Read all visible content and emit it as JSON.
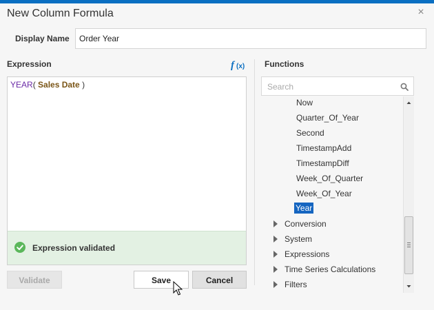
{
  "dialog": {
    "title": "New Column Formula",
    "close_glyph": "×"
  },
  "display_name": {
    "label": "Display Name",
    "value": "Order Year"
  },
  "expression": {
    "label": "Expression",
    "fx_icon": "function-fx-icon",
    "tokens": {
      "function": "YEAR",
      "open_paren": "(",
      "column": " Sales Date ",
      "close_paren": ")"
    },
    "validation": {
      "icon": "check-circle-icon",
      "color": "#5bb75b",
      "message": "Expression validated"
    }
  },
  "buttons": {
    "validate": "Validate",
    "save": "Save",
    "cancel": "Cancel"
  },
  "functions_panel": {
    "label": "Functions",
    "search_placeholder": "Search",
    "search_icon": "magnifier-icon",
    "leaf_items": [
      "Now",
      "Quarter_Of_Year",
      "Second",
      "TimestampAdd",
      "TimestampDiff",
      "Week_Of_Quarter",
      "Week_Of_Year"
    ],
    "selected_item": "Year",
    "groups": [
      "Conversion",
      "System",
      "Expressions",
      "Time Series Calculations",
      "Filters"
    ]
  },
  "colors": {
    "accent": "#0a6fc2",
    "selection": "#1565c0",
    "validated_bg": "#e3f1e3"
  }
}
